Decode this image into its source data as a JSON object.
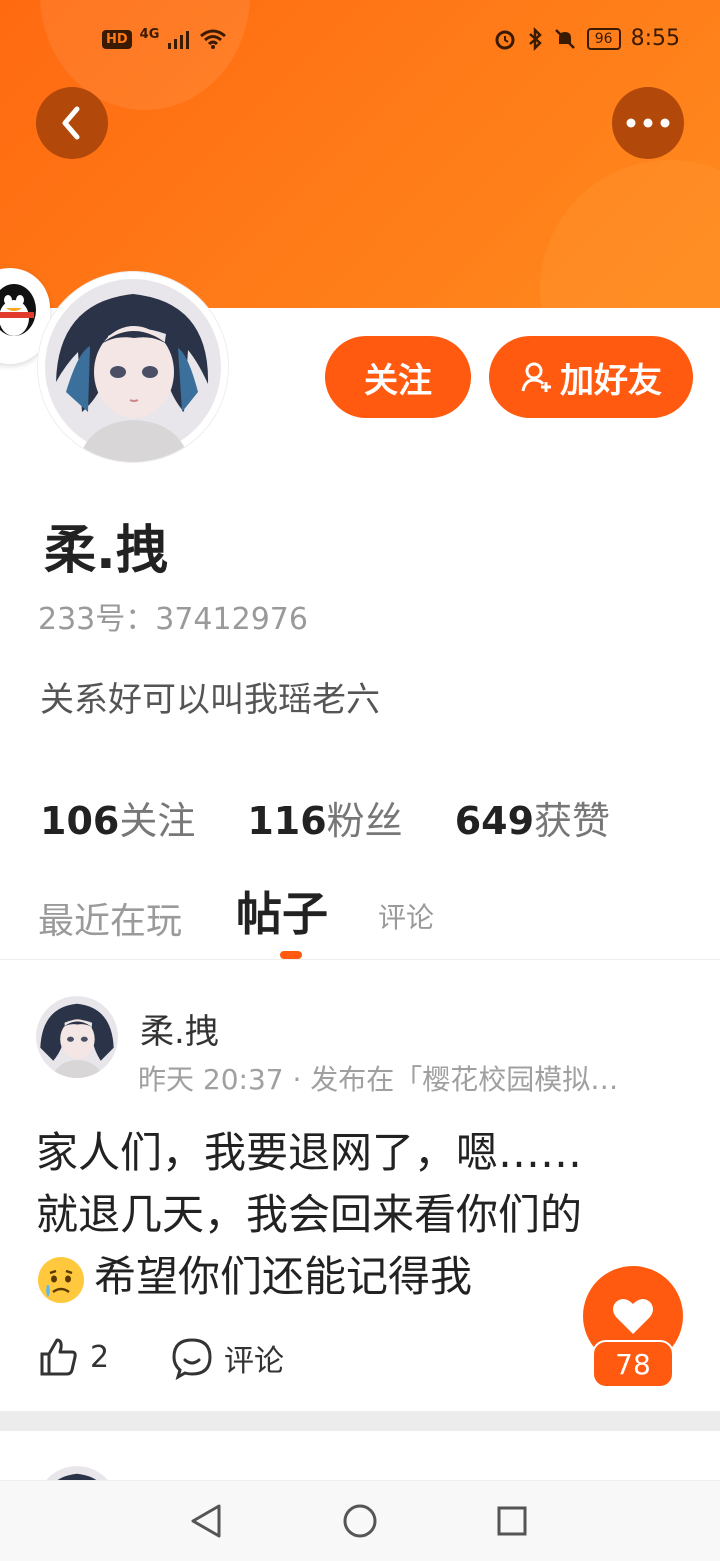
{
  "status_bar": {
    "hd": "HD",
    "network": "4G",
    "battery": "96",
    "time": "8:55"
  },
  "header": {
    "back_icon": "chevron-left-icon",
    "more_icon": "more-dots-icon"
  },
  "profile": {
    "username": "柔.拽",
    "uid_text": "233号：37412976",
    "bio": "关系好可以叫我瑶老六",
    "follow_label": "关注",
    "add_friend_label": "加好友",
    "stats": [
      {
        "num": "106",
        "label": "关注"
      },
      {
        "num": "116",
        "label": "粉丝"
      },
      {
        "num": "649",
        "label": "获赞"
      }
    ]
  },
  "tabs": [
    {
      "label": "最近在玩"
    },
    {
      "label": "帖子"
    },
    {
      "label": "评论"
    }
  ],
  "post": {
    "author": "柔.拽",
    "meta": "昨天 20:37 · 发布在「樱花校园模拟…",
    "lines": [
      "家人们，我要退网了，嗯……",
      "就退几天，我会回来看你们的",
      "希望你们还能记得我"
    ],
    "like_count": "2",
    "comment_label": "评论",
    "heart_count": "78"
  },
  "colors": {
    "accent": "#ff5a10",
    "header_orange": "#ff7a18"
  }
}
